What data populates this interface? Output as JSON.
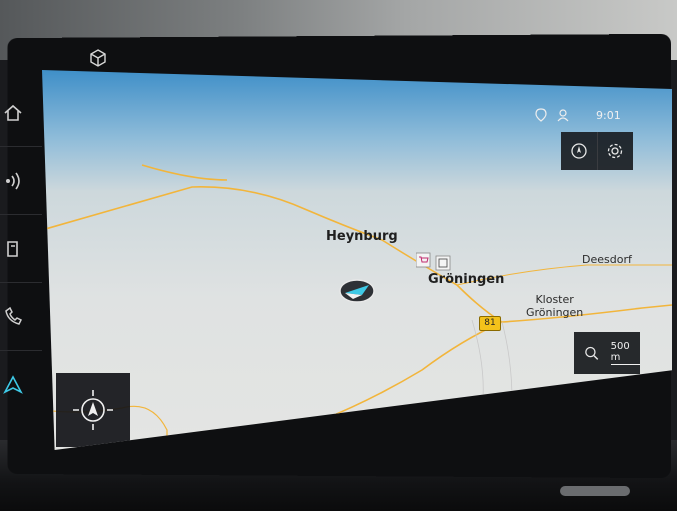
{
  "status_bar": {
    "time": "9:01",
    "icons": [
      "location-alert-icon",
      "user-icon"
    ]
  },
  "map": {
    "places": {
      "heynburg": "Heynburg",
      "groningen": "Gröningen",
      "deesdorf": "Deesdorf",
      "kloster_line1": "Kloster",
      "kloster_line2": "Gröningen"
    },
    "road_badge": "81",
    "scale": "500 m",
    "poi_icons": [
      "shopping-cart-icon",
      "building-icon"
    ]
  },
  "controls": {
    "top_right": [
      "compass-north-icon",
      "settings-icon"
    ],
    "zoom_icon": "search-icon",
    "recenter_icon": "navigation-arrow-icon"
  },
  "left_dock": [
    "home-icon",
    "radio-icon",
    "music-icon",
    "phone-icon",
    "nav-icon"
  ],
  "colors": {
    "sky_top": "#3f8fc8",
    "map_bg": "#dfe2e2",
    "road": "#f2b53b",
    "panel": "#141619",
    "accent": "#3ec9e6"
  }
}
